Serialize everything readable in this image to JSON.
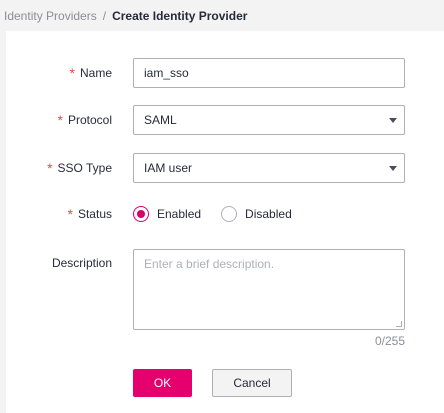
{
  "breadcrumb": {
    "parent": "Identity Providers",
    "separator": "/",
    "current": "Create Identity Provider"
  },
  "form": {
    "required_mark": "*",
    "name": {
      "label": "Name",
      "value": "iam_sso"
    },
    "protocol": {
      "label": "Protocol",
      "value": "SAML"
    },
    "sso_type": {
      "label": "SSO Type",
      "value": "IAM user"
    },
    "status": {
      "label": "Status",
      "options": [
        {
          "label": "Enabled",
          "selected": true
        },
        {
          "label": "Disabled",
          "selected": false
        }
      ]
    },
    "description": {
      "label": "Description",
      "value": "",
      "placeholder": "Enter a brief description.",
      "counter": "0/255"
    }
  },
  "actions": {
    "ok_label": "OK",
    "cancel_label": "Cancel"
  },
  "colors": {
    "accent": "#e6006e",
    "required": "#e04a4a"
  }
}
